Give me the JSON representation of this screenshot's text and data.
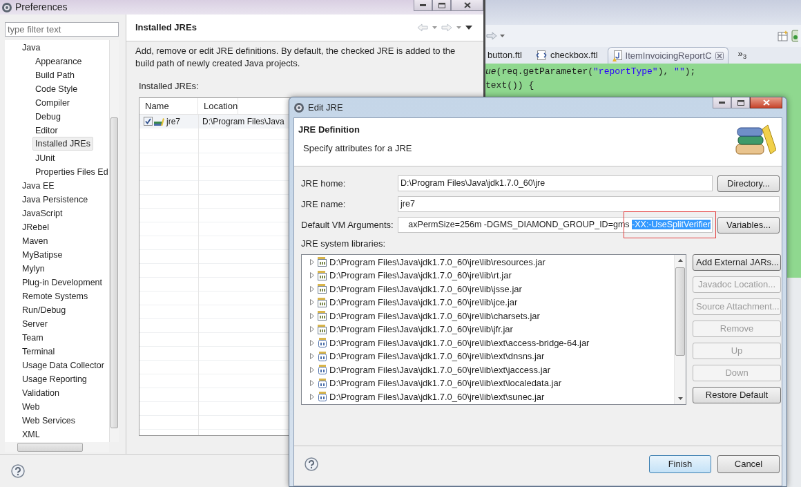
{
  "ide": {
    "editor_tabs": [
      {
        "label": "button.ftl",
        "kind": "text",
        "selected": false,
        "closable": false
      },
      {
        "label": "checkbox.ftl",
        "kind": "ftl",
        "selected": false,
        "closable": false
      },
      {
        "label": "ItemInvoicingReportC",
        "kind": "java",
        "selected": true,
        "closable": true
      }
    ],
    "tab_overflow": "»$_{3}$",
    "code_lines": [
      {
        "tokens": [
          {
            "text": "ue",
            "kind": "static"
          },
          {
            "text": "(req.getParameter(",
            "kind": "plain"
          },
          {
            "text": "\"reportType\"",
            "kind": "string"
          },
          {
            "text": "), ",
            "kind": "plain"
          },
          {
            "text": "\"\"",
            "kind": "string"
          },
          {
            "text": ");",
            "kind": "plain"
          }
        ]
      },
      {
        "tokens": [
          {
            "text": "text()) {",
            "kind": "plain"
          }
        ]
      }
    ]
  },
  "preferences": {
    "title": "Preferences",
    "filter": {
      "placeholder": "type filter text"
    },
    "tree": [
      {
        "label": "Java",
        "selected": false,
        "children": [
          {
            "label": "Appearance",
            "selected": false
          },
          {
            "label": "Build Path",
            "selected": false
          },
          {
            "label": "Code Style",
            "selected": false
          },
          {
            "label": "Compiler",
            "selected": false
          },
          {
            "label": "Debug",
            "selected": false
          },
          {
            "label": "Editor",
            "selected": false
          },
          {
            "label": "Installed JREs",
            "selected": true
          },
          {
            "label": "JUnit",
            "selected": false
          },
          {
            "label": "Properties Files Ed",
            "selected": false
          }
        ]
      },
      {
        "label": "Java EE",
        "selected": false
      },
      {
        "label": "Java Persistence",
        "selected": false
      },
      {
        "label": "JavaScript",
        "selected": false
      },
      {
        "label": "JRebel",
        "selected": false
      },
      {
        "label": "Maven",
        "selected": false
      },
      {
        "label": "MyBatipse",
        "selected": false
      },
      {
        "label": "Mylyn",
        "selected": false
      },
      {
        "label": "Plug-in Development",
        "selected": false
      },
      {
        "label": "Remote Systems",
        "selected": false
      },
      {
        "label": "Run/Debug",
        "selected": false
      },
      {
        "label": "Server",
        "selected": false
      },
      {
        "label": "Team",
        "selected": false
      },
      {
        "label": "Terminal",
        "selected": false
      },
      {
        "label": "Usage Data Collector",
        "selected": false
      },
      {
        "label": "Usage Reporting",
        "selected": false
      },
      {
        "label": "Validation",
        "selected": false
      },
      {
        "label": "Web",
        "selected": false
      },
      {
        "label": "Web Services",
        "selected": false
      },
      {
        "label": "XML",
        "selected": false
      }
    ],
    "page": {
      "title": "Installed JREs",
      "description": "Add, remove or edit JRE definitions. By default, the checked JRE is added to the build path of newly created Java projects.",
      "table_label": "Installed JREs:",
      "columns": [
        "Name",
        "Location"
      ],
      "rows": [
        {
          "name": "jre7",
          "location": "D:\\Program Files\\Java",
          "checked": true
        }
      ]
    }
  },
  "edit_jre": {
    "title": "Edit JRE",
    "header": {
      "title": "JRE Definition",
      "subtitle": "Specify attributes for a JRE"
    },
    "fields": [
      {
        "label": "JRE home:",
        "value": "D:\\Program Files\\Java\\jdk1.7.0_60\\jre",
        "button": "Directory..."
      },
      {
        "label": "JRE name:",
        "value": "jre7"
      },
      {
        "label": "Default VM Arguments:",
        "value": "axPermSize=256m -DGMS_DIAMOND_GROUP_ID=gms",
        "selected_text": "-XX:-UseSplitVerifier",
        "highlighted": true,
        "button": "Variables..."
      }
    ],
    "libraries_label": "JRE system libraries:",
    "libraries": [
      {
        "path": "D:\\Program Files\\Java\\jdk1.7.0_60\\jre\\lib\\resources.jar",
        "kind": "jar",
        "expanded": false
      },
      {
        "path": "D:\\Program Files\\Java\\jdk1.7.0_60\\jre\\lib\\rt.jar",
        "kind": "jar",
        "expanded": false
      },
      {
        "path": "D:\\Program Files\\Java\\jdk1.7.0_60\\jre\\lib\\jsse.jar",
        "kind": "jar",
        "expanded": false
      },
      {
        "path": "D:\\Program Files\\Java\\jdk1.7.0_60\\jre\\lib\\jce.jar",
        "kind": "jar",
        "expanded": false
      },
      {
        "path": "D:\\Program Files\\Java\\jdk1.7.0_60\\jre\\lib\\charsets.jar",
        "kind": "jar",
        "expanded": false
      },
      {
        "path": "D:\\Program Files\\Java\\jdk1.7.0_60\\jre\\lib\\jfr.jar",
        "kind": "jar",
        "expanded": false
      },
      {
        "path": "D:\\Program Files\\Java\\jdk1.7.0_60\\jre\\lib\\ext\\access-bridge-64.jar",
        "kind": "ext",
        "expanded": false
      },
      {
        "path": "D:\\Program Files\\Java\\jdk1.7.0_60\\jre\\lib\\ext\\dnsns.jar",
        "kind": "ext",
        "expanded": false
      },
      {
        "path": "D:\\Program Files\\Java\\jdk1.7.0_60\\jre\\lib\\ext\\jaccess.jar",
        "kind": "ext",
        "expanded": false
      },
      {
        "path": "D:\\Program Files\\Java\\jdk1.7.0_60\\jre\\lib\\ext\\localedata.jar",
        "kind": "ext",
        "expanded": false
      },
      {
        "path": "D:\\Program Files\\Java\\jdk1.7.0_60\\jre\\lib\\ext\\sunec.jar",
        "kind": "ext",
        "expanded": false
      }
    ],
    "side_buttons": [
      {
        "label": "Add External JARs...",
        "disabled": false
      },
      {
        "label": "Javadoc Location...",
        "disabled": true
      },
      {
        "label": "Source Attachment...",
        "disabled": true
      },
      {
        "label": "Remove",
        "disabled": true
      },
      {
        "label": "Up",
        "disabled": true
      },
      {
        "label": "Down",
        "disabled": true
      },
      {
        "label": "Restore Default",
        "disabled": false
      }
    ],
    "footer_buttons": [
      {
        "label": "Finish",
        "default": true
      },
      {
        "label": "Cancel",
        "default": false
      }
    ]
  }
}
